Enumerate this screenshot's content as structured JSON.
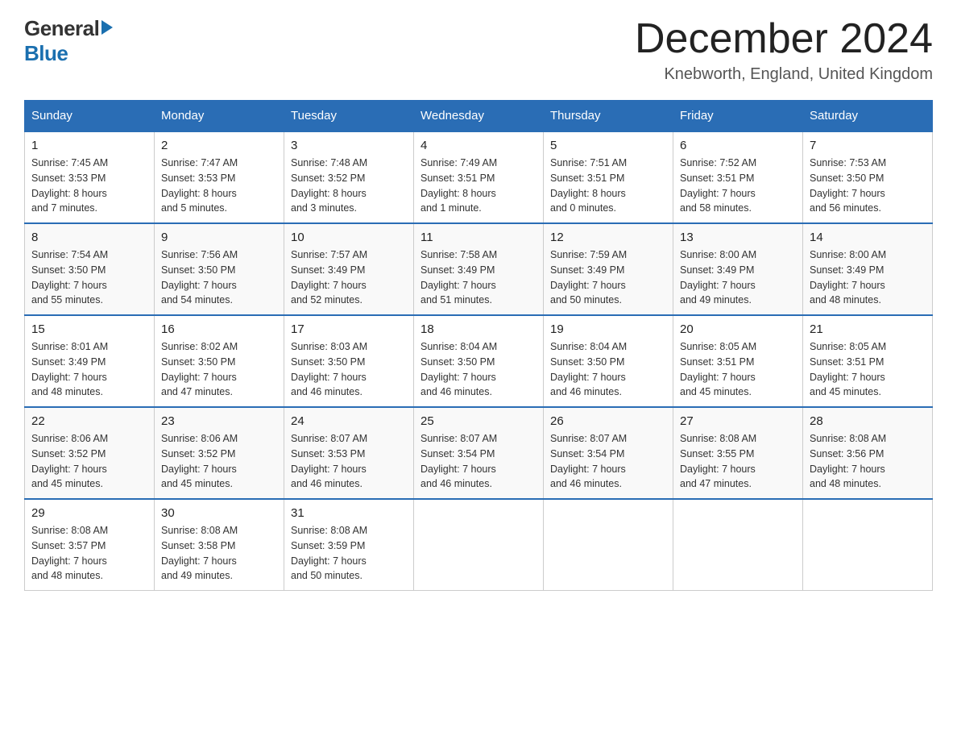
{
  "header": {
    "logo_general": "General",
    "logo_blue": "Blue",
    "month_title": "December 2024",
    "location": "Knebworth, England, United Kingdom"
  },
  "columns": [
    "Sunday",
    "Monday",
    "Tuesday",
    "Wednesday",
    "Thursday",
    "Friday",
    "Saturday"
  ],
  "weeks": [
    [
      {
        "day": "1",
        "info": "Sunrise: 7:45 AM\nSunset: 3:53 PM\nDaylight: 8 hours\nand 7 minutes."
      },
      {
        "day": "2",
        "info": "Sunrise: 7:47 AM\nSunset: 3:53 PM\nDaylight: 8 hours\nand 5 minutes."
      },
      {
        "day": "3",
        "info": "Sunrise: 7:48 AM\nSunset: 3:52 PM\nDaylight: 8 hours\nand 3 minutes."
      },
      {
        "day": "4",
        "info": "Sunrise: 7:49 AM\nSunset: 3:51 PM\nDaylight: 8 hours\nand 1 minute."
      },
      {
        "day": "5",
        "info": "Sunrise: 7:51 AM\nSunset: 3:51 PM\nDaylight: 8 hours\nand 0 minutes."
      },
      {
        "day": "6",
        "info": "Sunrise: 7:52 AM\nSunset: 3:51 PM\nDaylight: 7 hours\nand 58 minutes."
      },
      {
        "day": "7",
        "info": "Sunrise: 7:53 AM\nSunset: 3:50 PM\nDaylight: 7 hours\nand 56 minutes."
      }
    ],
    [
      {
        "day": "8",
        "info": "Sunrise: 7:54 AM\nSunset: 3:50 PM\nDaylight: 7 hours\nand 55 minutes."
      },
      {
        "day": "9",
        "info": "Sunrise: 7:56 AM\nSunset: 3:50 PM\nDaylight: 7 hours\nand 54 minutes."
      },
      {
        "day": "10",
        "info": "Sunrise: 7:57 AM\nSunset: 3:49 PM\nDaylight: 7 hours\nand 52 minutes."
      },
      {
        "day": "11",
        "info": "Sunrise: 7:58 AM\nSunset: 3:49 PM\nDaylight: 7 hours\nand 51 minutes."
      },
      {
        "day": "12",
        "info": "Sunrise: 7:59 AM\nSunset: 3:49 PM\nDaylight: 7 hours\nand 50 minutes."
      },
      {
        "day": "13",
        "info": "Sunrise: 8:00 AM\nSunset: 3:49 PM\nDaylight: 7 hours\nand 49 minutes."
      },
      {
        "day": "14",
        "info": "Sunrise: 8:00 AM\nSunset: 3:49 PM\nDaylight: 7 hours\nand 48 minutes."
      }
    ],
    [
      {
        "day": "15",
        "info": "Sunrise: 8:01 AM\nSunset: 3:49 PM\nDaylight: 7 hours\nand 48 minutes."
      },
      {
        "day": "16",
        "info": "Sunrise: 8:02 AM\nSunset: 3:50 PM\nDaylight: 7 hours\nand 47 minutes."
      },
      {
        "day": "17",
        "info": "Sunrise: 8:03 AM\nSunset: 3:50 PM\nDaylight: 7 hours\nand 46 minutes."
      },
      {
        "day": "18",
        "info": "Sunrise: 8:04 AM\nSunset: 3:50 PM\nDaylight: 7 hours\nand 46 minutes."
      },
      {
        "day": "19",
        "info": "Sunrise: 8:04 AM\nSunset: 3:50 PM\nDaylight: 7 hours\nand 46 minutes."
      },
      {
        "day": "20",
        "info": "Sunrise: 8:05 AM\nSunset: 3:51 PM\nDaylight: 7 hours\nand 45 minutes."
      },
      {
        "day": "21",
        "info": "Sunrise: 8:05 AM\nSunset: 3:51 PM\nDaylight: 7 hours\nand 45 minutes."
      }
    ],
    [
      {
        "day": "22",
        "info": "Sunrise: 8:06 AM\nSunset: 3:52 PM\nDaylight: 7 hours\nand 45 minutes."
      },
      {
        "day": "23",
        "info": "Sunrise: 8:06 AM\nSunset: 3:52 PM\nDaylight: 7 hours\nand 45 minutes."
      },
      {
        "day": "24",
        "info": "Sunrise: 8:07 AM\nSunset: 3:53 PM\nDaylight: 7 hours\nand 46 minutes."
      },
      {
        "day": "25",
        "info": "Sunrise: 8:07 AM\nSunset: 3:54 PM\nDaylight: 7 hours\nand 46 minutes."
      },
      {
        "day": "26",
        "info": "Sunrise: 8:07 AM\nSunset: 3:54 PM\nDaylight: 7 hours\nand 46 minutes."
      },
      {
        "day": "27",
        "info": "Sunrise: 8:08 AM\nSunset: 3:55 PM\nDaylight: 7 hours\nand 47 minutes."
      },
      {
        "day": "28",
        "info": "Sunrise: 8:08 AM\nSunset: 3:56 PM\nDaylight: 7 hours\nand 48 minutes."
      }
    ],
    [
      {
        "day": "29",
        "info": "Sunrise: 8:08 AM\nSunset: 3:57 PM\nDaylight: 7 hours\nand 48 minutes."
      },
      {
        "day": "30",
        "info": "Sunrise: 8:08 AM\nSunset: 3:58 PM\nDaylight: 7 hours\nand 49 minutes."
      },
      {
        "day": "31",
        "info": "Sunrise: 8:08 AM\nSunset: 3:59 PM\nDaylight: 7 hours\nand 50 minutes."
      },
      {
        "day": "",
        "info": ""
      },
      {
        "day": "",
        "info": ""
      },
      {
        "day": "",
        "info": ""
      },
      {
        "day": "",
        "info": ""
      }
    ]
  ]
}
